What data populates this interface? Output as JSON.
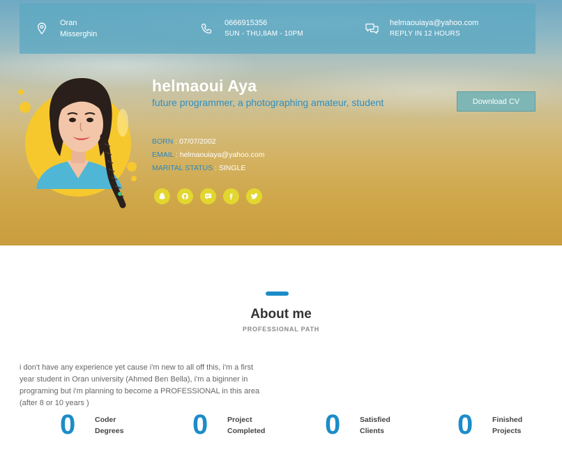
{
  "contact": {
    "location": {
      "line1": "Oran",
      "line2": "Misserghin",
      "icon": "location-pin-icon"
    },
    "phone": {
      "line1": "0666915356",
      "line2": "SUN - THU,8AM - 10PM",
      "icon": "phone-icon"
    },
    "email": {
      "line1": "helmaouiaya@yahoo.com",
      "line2": "REPLY IN 12 HOURS",
      "icon": "chat-bubbles-icon"
    }
  },
  "profile": {
    "name": "helmaoui Aya",
    "tagline": "future programmer, a photographing amateur, student",
    "born_label": "BORN",
    "born_value": " : 07/07/2002",
    "email_label": "EMAIL",
    "email_value": " : helmaouiaya@yahoo.com",
    "marital_label": "MARITAL STATUS",
    "marital_value": " : SINGLE",
    "socials": [
      "snapchat-icon",
      "github-icon",
      "message-icon",
      "facebook-icon",
      "twitter-icon"
    ]
  },
  "download_cv_label": "Download CV",
  "about": {
    "title": "About me",
    "subtitle": "PROFESSIONAL PATH",
    "text": "i don't have any experience yet cause i'm new to all off this, i'm a first year student in Oran university (Ahmed Ben Bella), i'm a biginner in programing but i'm planning to become a PROFESSIONAL in this area (after 8 or 10 years )"
  },
  "stats": [
    {
      "value": "0",
      "line1": "Coder",
      "line2": "Degrees"
    },
    {
      "value": "0",
      "line1": "Project",
      "line2": "Completed"
    },
    {
      "value": "0",
      "line1": "Satisfied",
      "line2": "Clients"
    },
    {
      "value": "0",
      "line1": "Finished",
      "line2": "Projects"
    }
  ],
  "colors": {
    "accent": "#1c8cc8",
    "social_button": "#e2d62f",
    "contact_bar": "#5ca8c2",
    "download_button": "#7db6b4"
  }
}
